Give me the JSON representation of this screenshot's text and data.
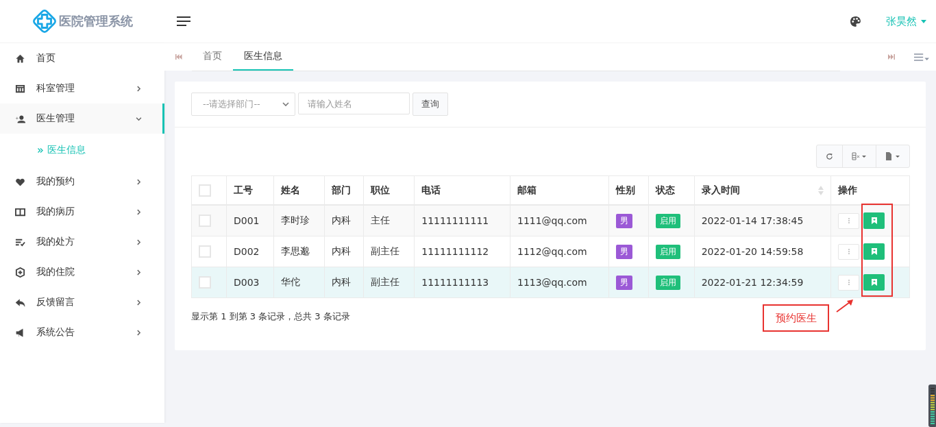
{
  "brand": {
    "title": "医院管理系统"
  },
  "sidebar": {
    "items": [
      {
        "kind": "home",
        "label": "首页",
        "selected": false
      },
      {
        "kind": "grid",
        "label": "科室管理",
        "selected": false,
        "expanded": false
      },
      {
        "kind": "user",
        "label": "医生管理",
        "selected": true,
        "expanded": true,
        "children": [
          {
            "label": "医生信息",
            "selected": true
          }
        ]
      },
      {
        "kind": "heart",
        "label": "我的预约",
        "selected": false,
        "expanded": false
      },
      {
        "kind": "card",
        "label": "我的病历",
        "selected": false,
        "expanded": false
      },
      {
        "kind": "list",
        "label": "我的处方",
        "selected": false,
        "expanded": false
      },
      {
        "kind": "hospital",
        "label": "我的住院",
        "selected": false,
        "expanded": false
      },
      {
        "kind": "reply",
        "label": "反馈留言",
        "selected": false,
        "expanded": false
      },
      {
        "kind": "bullhorn",
        "label": "系统公告",
        "selected": false,
        "expanded": false
      }
    ]
  },
  "header": {
    "user": "张昊然"
  },
  "tabs": [
    {
      "label": "首页",
      "selected": false
    },
    {
      "label": "医生信息",
      "selected": true
    }
  ],
  "filters": {
    "department_placeholder": "--请选择部门--",
    "name_placeholder": "请输入姓名",
    "search_button": "查询"
  },
  "table": {
    "select_all_checked": false,
    "columns": [
      {
        "label": "工号",
        "sortable": false
      },
      {
        "label": "姓名",
        "sortable": false
      },
      {
        "label": "部门",
        "sortable": false
      },
      {
        "label": "职位",
        "sortable": false
      },
      {
        "label": "电话",
        "sortable": false
      },
      {
        "label": "邮箱",
        "sortable": false
      },
      {
        "label": "性别",
        "sortable": false
      },
      {
        "label": "状态",
        "sortable": false
      },
      {
        "label": "录入时间",
        "sortable": true
      },
      {
        "label": "操作",
        "sortable": false
      }
    ],
    "rows": [
      {
        "checked": false,
        "highlighted": false,
        "id": "D001",
        "name": "李时珍",
        "department": "内科",
        "position": "主任",
        "phone": "11111111111",
        "email": "1111@qq.com",
        "gender": "男",
        "status": "启用",
        "created": "2022-01-14 17:38:45"
      },
      {
        "checked": false,
        "highlighted": false,
        "id": "D002",
        "name": "李思邈",
        "department": "内科",
        "position": "副主任",
        "phone": "11111111112",
        "email": "1112@qq.com",
        "gender": "男",
        "status": "启用",
        "created": "2022-01-20 14:59:58"
      },
      {
        "checked": false,
        "highlighted": true,
        "id": "D003",
        "name": "华佗",
        "department": "内科",
        "position": "副主任",
        "phone": "11111111113",
        "email": "1113@qq.com",
        "gender": "男",
        "status": "启用",
        "created": "2022-01-21 12:34:59"
      }
    ]
  },
  "pagination": {
    "summary": "显示第 1 到第 3 条记录，总共 3 条记录"
  },
  "annotation": {
    "label": "预约医生"
  }
}
